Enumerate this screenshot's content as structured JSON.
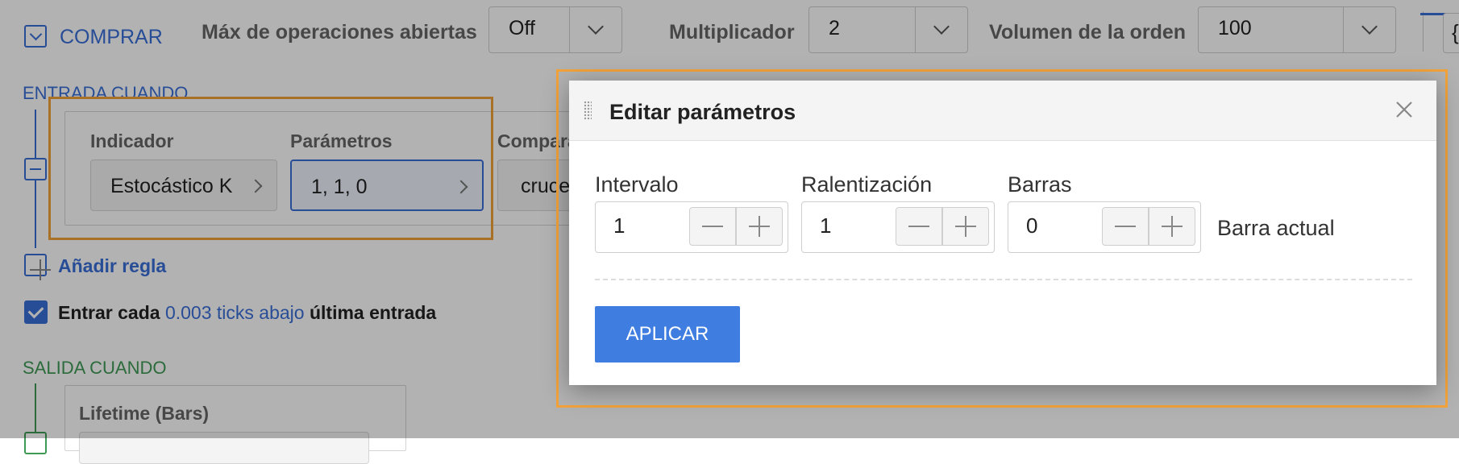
{
  "header": {
    "buy_label": "COMPRAR",
    "max_open_label": "Máx de operaciones abiertas",
    "max_open_value": "Off",
    "multiplier_label": "Multiplicador",
    "multiplier_value": "2",
    "order_volume_label": "Volumen de la orden",
    "order_volume_value": "100",
    "right_edge_glyph": "{"
  },
  "entry": {
    "title": "ENTRADA CUANDO",
    "indicator_label": "Indicador",
    "indicator_value": "Estocástico K",
    "params_label": "Parámetros",
    "params_value": "1, 1, 0",
    "compare_label": "Compara",
    "compare_value": "cruce",
    "add_rule_label": "Añadir regla",
    "enter_every_prefix": "Entrar cada",
    "enter_every_link": "0.003 ticks abajo",
    "enter_every_suffix": "última entrada",
    "enter_every_checked": true
  },
  "exit": {
    "title": "SALIDA CUANDO",
    "lifetime_label": "Lifetime (Bars)"
  },
  "modal": {
    "title": "Editar parámetros",
    "fields": [
      {
        "label": "Intervalo",
        "value": "1"
      },
      {
        "label": "Ralentización",
        "value": "1"
      },
      {
        "label": "Barras",
        "value": "0"
      }
    ],
    "bar_note": "Barra actual",
    "apply_label": "APLICAR"
  },
  "colors": {
    "accent": "#3a6fd8",
    "exit": "#3f9a55",
    "highlight": "#f3a33a",
    "apply": "#3f7de0"
  }
}
